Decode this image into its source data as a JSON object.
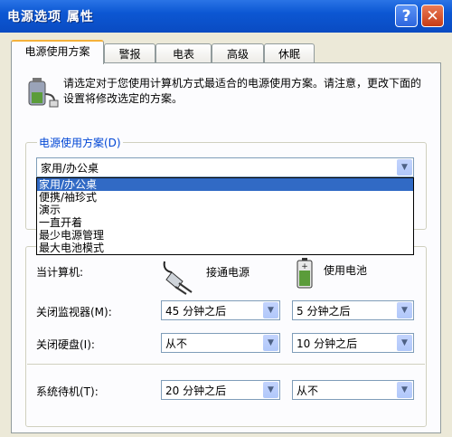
{
  "window": {
    "title": "电源选项 属性",
    "help_label": "?",
    "close_label": "✕"
  },
  "tabs": [
    "电源使用方案",
    "警报",
    "电表",
    "高级",
    "休眠"
  ],
  "description": "请选定对于您使用计算机方式最适合的电源使用方案。请注意，更改下面的设置将修改选定的方案。",
  "scheme_group": {
    "legend": "电源使用方案(D)",
    "selected": "家用/办公桌",
    "options": [
      "家用/办公桌",
      "便携/袖珍式",
      "演示",
      "一直开着",
      "最少电源管理",
      "最大电池模式"
    ]
  },
  "settings": {
    "computer_label": "当计算机:",
    "ac_label": "接通电源",
    "battery_label": "使用电池",
    "rows": [
      {
        "label": "关闭监视器(M):",
        "ac": "45 分钟之后",
        "battery": "5 分钟之后"
      },
      {
        "label": "关闭硬盘(I):",
        "ac": "从不",
        "battery": "10 分钟之后"
      },
      {
        "label": "系统待机(T):",
        "ac": "20 分钟之后",
        "battery": "从不"
      }
    ]
  },
  "icons": {
    "power_options": "power-options-icon",
    "plug": "plug-icon",
    "battery": "battery-icon",
    "dropdown_arrow": "chevron-down-icon"
  },
  "colors": {
    "titlebar": "#0c57d3",
    "selection": "#316ac5",
    "legend": "#0046d5",
    "tab_highlight": "#f5b13a"
  }
}
